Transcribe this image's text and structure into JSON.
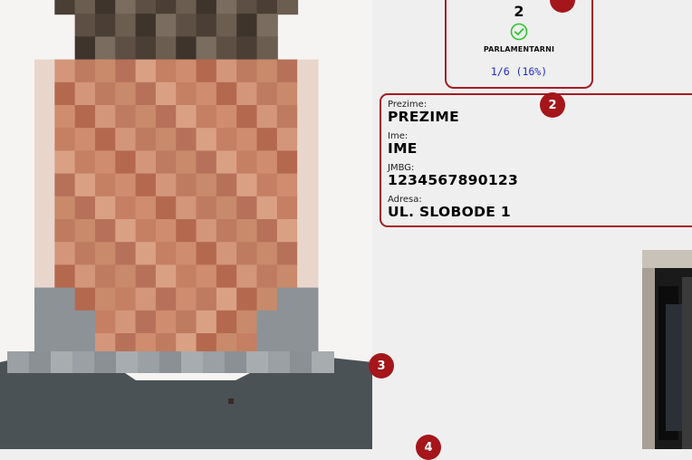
{
  "counter": {
    "value": "2",
    "status_icon": "check-circle-icon",
    "label": "PARLAMENTARNI",
    "ratio": "1/6 (16%)"
  },
  "id_card": {
    "surname_label": "Prezime:",
    "surname_value": "PREZIME",
    "name_label": "Ime:",
    "name_value": "IME",
    "jmbg_label": "JMBG:",
    "jmbg_value": "1234567890123",
    "address_label": "Adresa:",
    "address_value": "UL. SLOBODE 1"
  },
  "badges": {
    "b2": "2",
    "b3": "3",
    "b4": "4"
  },
  "colors": {
    "accent": "#a51c24",
    "badge": "#a4161a",
    "ratio_text": "#1f2bd6",
    "check": "#2fc42f"
  }
}
